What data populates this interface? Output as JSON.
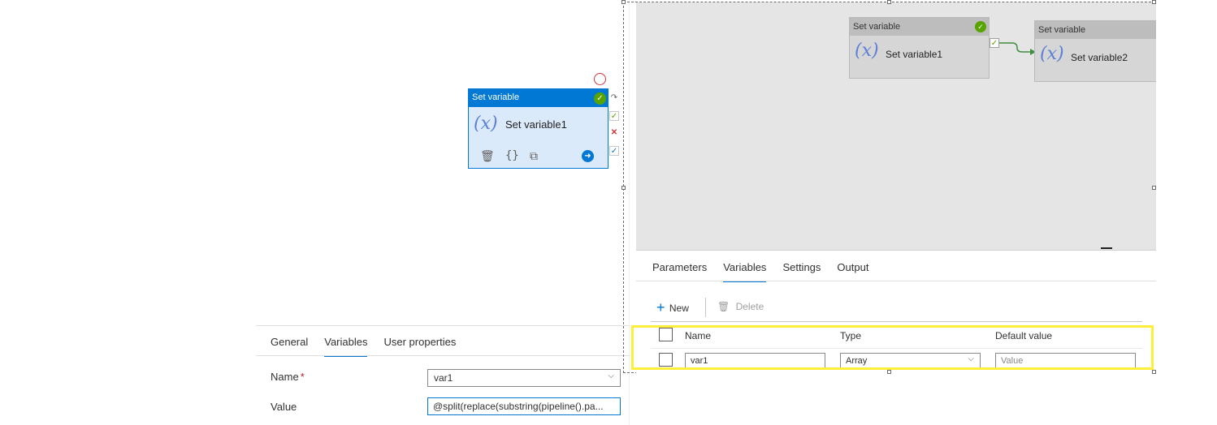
{
  "left": {
    "activity": {
      "type": "Set variable",
      "name": "Set variable1"
    },
    "tabs": [
      "General",
      "Variables",
      "User properties"
    ],
    "active_tab": "Variables",
    "form": {
      "name_label": "Name",
      "name_required_mark": "*",
      "name_value": "var1",
      "value_label": "Value",
      "value_value": "@split(replace(substring(pipeline().pa..."
    }
  },
  "right": {
    "nodes": [
      {
        "type": "Set variable",
        "name": "Set variable1"
      },
      {
        "type": "Set variable",
        "name": "Set variable2"
      }
    ],
    "tabs": [
      "Parameters",
      "Variables",
      "Settings",
      "Output"
    ],
    "active_tab": "Variables",
    "toolbar": {
      "new_label": "New",
      "delete_label": "Delete"
    },
    "grid": {
      "headers": [
        "Name",
        "Type",
        "Default value"
      ],
      "rows": [
        {
          "name": "var1",
          "type": "Array",
          "default_placeholder": "Value"
        }
      ]
    }
  },
  "colors": {
    "accent": "#0078d4",
    "success": "#57a300",
    "error": "#d13438",
    "highlight": "#ffef3b"
  },
  "icons": [
    "check-circle-icon",
    "trash-icon",
    "braces-icon",
    "copy-icon",
    "arrow-right-icon",
    "plus-icon",
    "chevron-down-icon"
  ]
}
